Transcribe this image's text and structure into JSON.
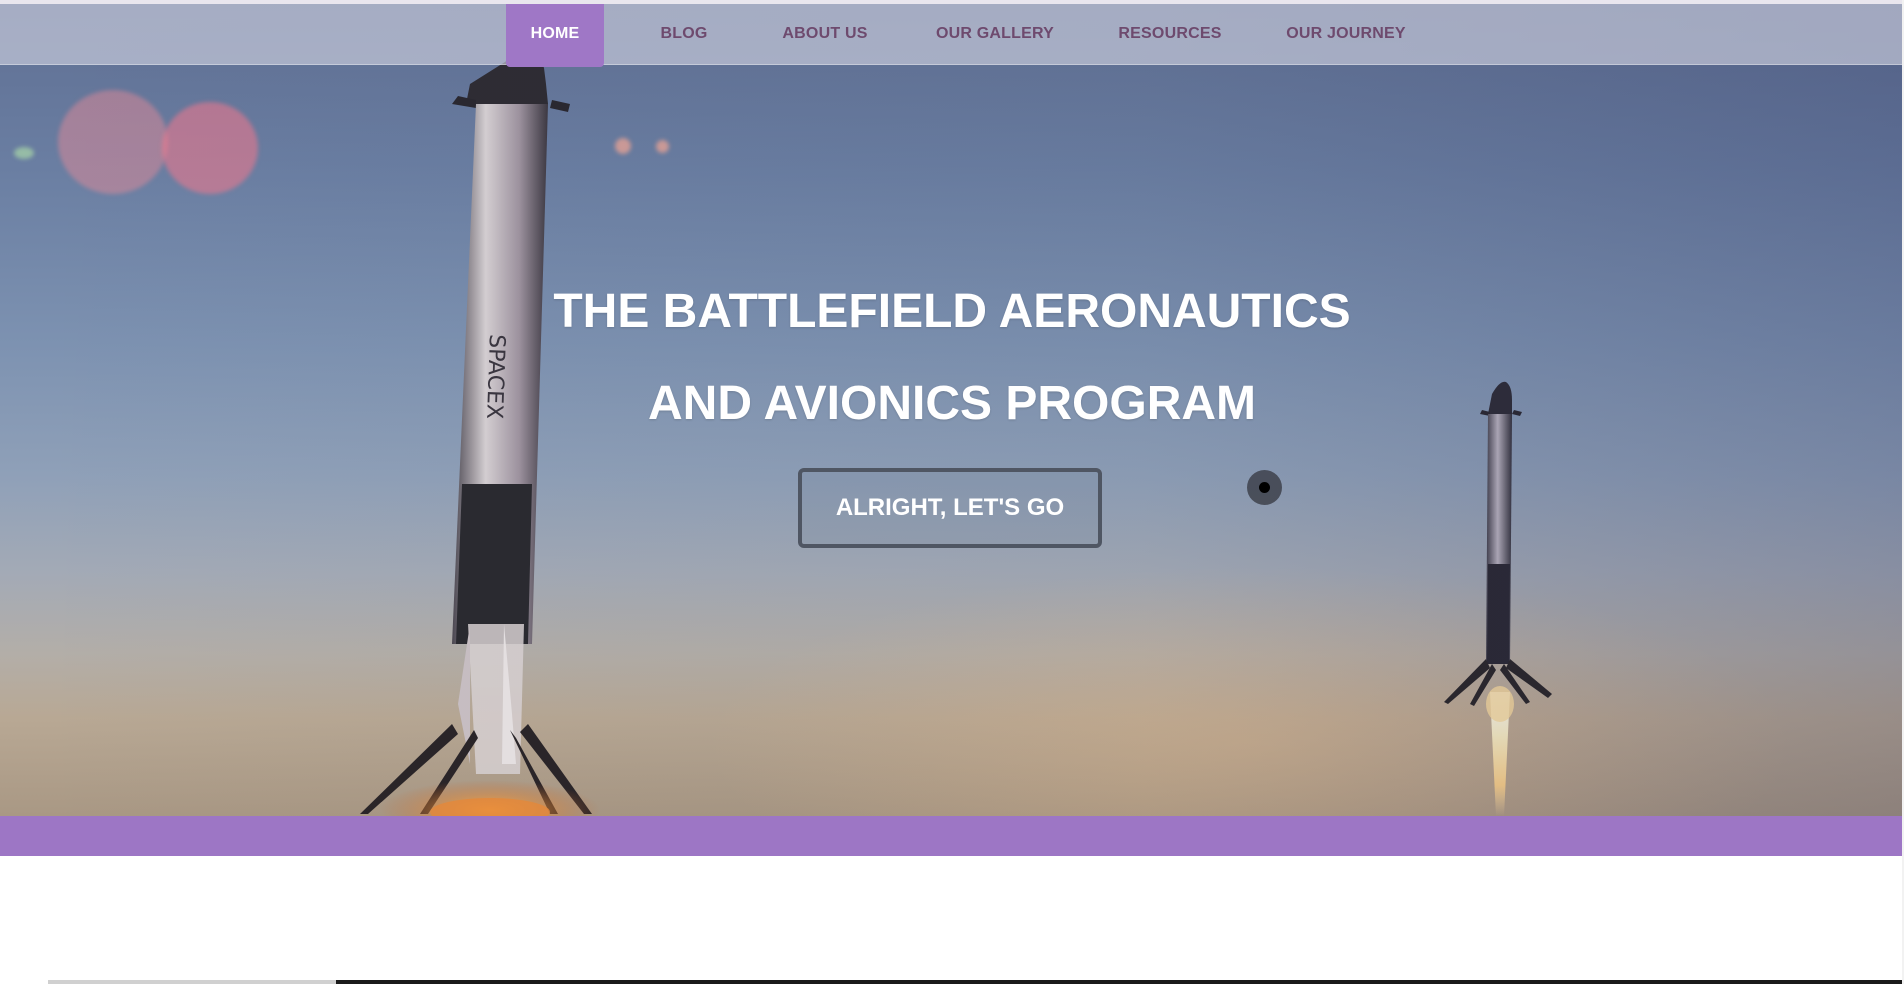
{
  "nav": {
    "items": [
      {
        "label": "HOME",
        "active": true
      },
      {
        "label": "BLOG",
        "active": false
      },
      {
        "label": "ABOUT US",
        "active": false
      },
      {
        "label": "OUR GALLERY",
        "active": false
      },
      {
        "label": "RESOURCES",
        "active": false
      },
      {
        "label": "OUR JOURNEY",
        "active": false
      }
    ]
  },
  "hero": {
    "title_line1": "THE BATTLEFIELD AERONAUTICS",
    "title_line2": "AND AVIONICS PROGRAM",
    "cta_label": "ALRIGHT, LET'S GO",
    "background": "rocket-landing-photo"
  },
  "colors": {
    "accent": "#9d76c5",
    "nav_text": "#6e4a6e",
    "nav_active_bg": "#9f77c6",
    "hero_text": "#ffffff",
    "cta_border": "#4f5663"
  }
}
